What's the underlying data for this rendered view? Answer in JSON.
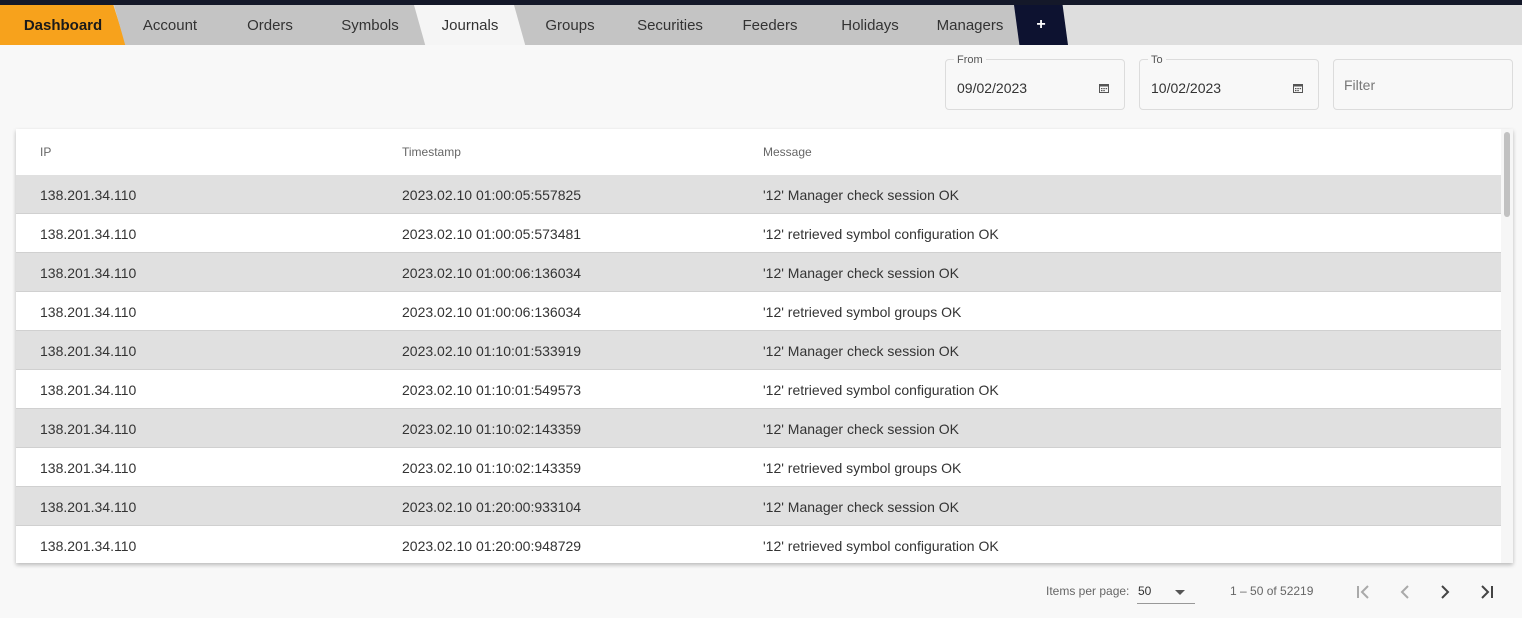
{
  "tabs": [
    {
      "label": "Dashboard"
    },
    {
      "label": "Account"
    },
    {
      "label": "Orders"
    },
    {
      "label": "Symbols"
    },
    {
      "label": "Journals"
    },
    {
      "label": "Groups"
    },
    {
      "label": "Securities"
    },
    {
      "label": "Feeders"
    },
    {
      "label": "Holidays"
    },
    {
      "label": "Managers"
    }
  ],
  "add_tab_label": "+",
  "active_tab": "Journals",
  "filters": {
    "from_label": "From",
    "from_value": "09/02/2023",
    "to_label": "To",
    "to_value": "10/02/2023",
    "filter_placeholder": "Filter"
  },
  "table": {
    "columns": [
      "IP",
      "Timestamp",
      "Message"
    ],
    "rows": [
      {
        "ip": "138.201.34.110",
        "timestamp": "2023.02.10 01:00:05:557825",
        "message": "'12' Manager check session OK"
      },
      {
        "ip": "138.201.34.110",
        "timestamp": "2023.02.10 01:00:05:573481",
        "message": "'12' retrieved symbol configuration OK"
      },
      {
        "ip": "138.201.34.110",
        "timestamp": "2023.02.10 01:00:06:136034",
        "message": "'12' Manager check session OK"
      },
      {
        "ip": "138.201.34.110",
        "timestamp": "2023.02.10 01:00:06:136034",
        "message": "'12' retrieved symbol groups OK"
      },
      {
        "ip": "138.201.34.110",
        "timestamp": "2023.02.10 01:10:01:533919",
        "message": "'12' Manager check session OK"
      },
      {
        "ip": "138.201.34.110",
        "timestamp": "2023.02.10 01:10:01:549573",
        "message": "'12' retrieved symbol configuration OK"
      },
      {
        "ip": "138.201.34.110",
        "timestamp": "2023.02.10 01:10:02:143359",
        "message": "'12' Manager check session OK"
      },
      {
        "ip": "138.201.34.110",
        "timestamp": "2023.02.10 01:10:02:143359",
        "message": "'12' retrieved symbol groups OK"
      },
      {
        "ip": "138.201.34.110",
        "timestamp": "2023.02.10 01:20:00:933104",
        "message": "'12' Manager check session OK"
      },
      {
        "ip": "138.201.34.110",
        "timestamp": "2023.02.10 01:20:00:948729",
        "message": "'12' retrieved symbol configuration OK"
      }
    ]
  },
  "paginator": {
    "items_per_page_label": "Items per page:",
    "items_per_page_value": "50",
    "range_label": "1 – 50 of 52219"
  },
  "colors": {
    "accent": "#f7a21c",
    "topbar": "#141829",
    "add_tab": "#0d1230",
    "row_shade": "#e0e0e0"
  },
  "icons": {
    "calendar": "calendar-icon",
    "first_page": "first-page-icon",
    "prev_page": "chevron-left-icon",
    "next_page": "chevron-right-icon",
    "last_page": "last-page-icon",
    "dropdown": "chevron-down-icon"
  }
}
